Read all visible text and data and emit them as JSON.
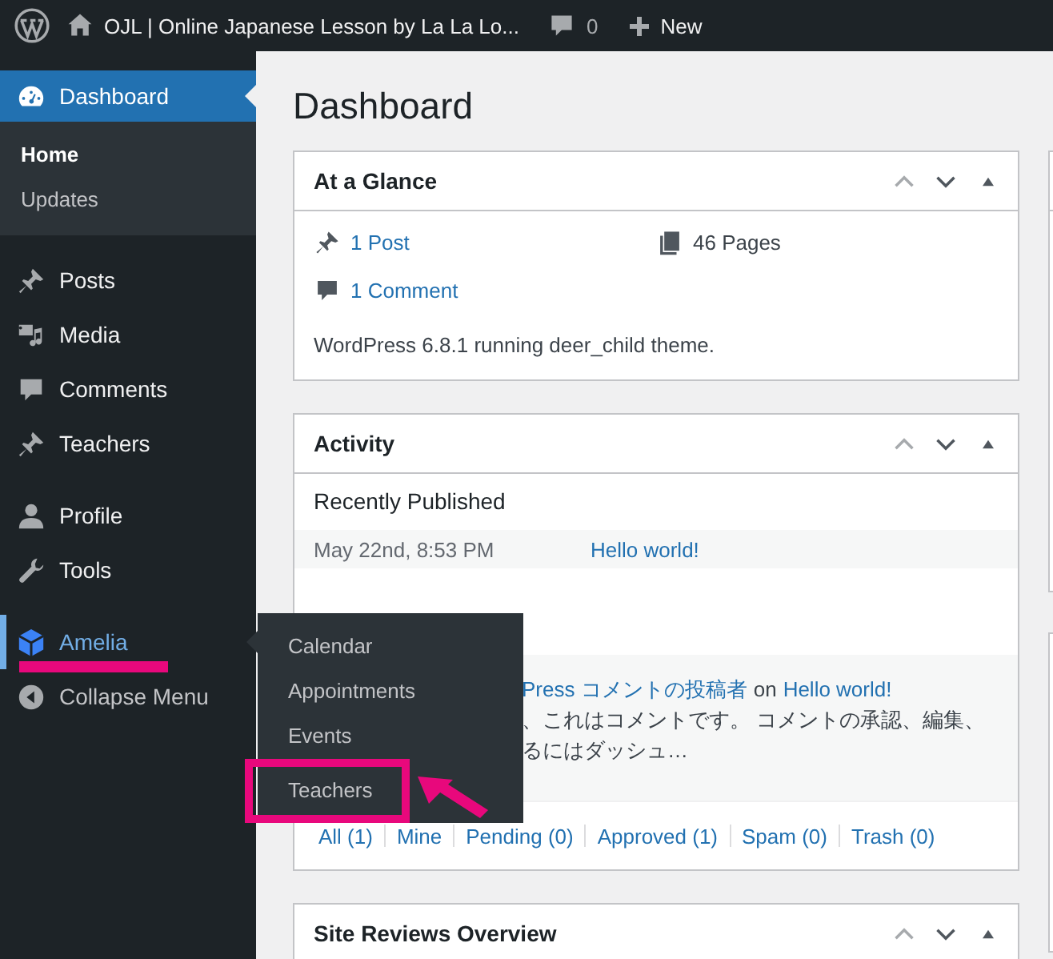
{
  "admin_bar": {
    "site_title": "OJL | Online Japanese Lesson by La La Lo...",
    "comment_count": "0",
    "new_label": "New"
  },
  "sidebar": {
    "groups": [
      [
        {
          "label": "Dashboard",
          "selected": true,
          "hovered": false,
          "underlined": false,
          "children": [
            {
              "label": "Home",
              "selected": true
            },
            {
              "label": "Updates",
              "selected": false
            }
          ]
        }
      ],
      [
        {
          "label": "Posts",
          "selected": false,
          "hovered": false,
          "underlined": false
        },
        {
          "label": "Media",
          "selected": false,
          "hovered": false,
          "underlined": false
        },
        {
          "label": "Comments",
          "selected": false,
          "hovered": false,
          "underlined": false
        },
        {
          "label": "Teachers",
          "selected": false,
          "hovered": false,
          "underlined": false
        }
      ],
      [
        {
          "label": "Profile",
          "selected": false,
          "hovered": false,
          "underlined": false
        },
        {
          "label": "Tools",
          "selected": false,
          "hovered": false,
          "underlined": false
        }
      ],
      [
        {
          "label": "Amelia",
          "selected": false,
          "hovered": true,
          "underlined": true
        }
      ]
    ],
    "collapse_label": "Collapse Menu"
  },
  "flyout": {
    "items": [
      {
        "label": "Calendar",
        "highlighted": false
      },
      {
        "label": "Appointments",
        "highlighted": false
      },
      {
        "label": "Events",
        "highlighted": false
      },
      {
        "label": "Teachers",
        "highlighted": true
      }
    ]
  },
  "page_title": "Dashboard",
  "at_a_glance": {
    "title": "At a Glance",
    "posts": "1 Post",
    "pages": "46 Pages",
    "comments": "1 Comment",
    "version_text": "WordPress 6.8.1 running deer_child theme."
  },
  "activity": {
    "title": "Activity",
    "recent_heading": "Recently Published",
    "published": [
      {
        "date": "May 22nd, 8:53 PM",
        "title": "Hello world!"
      }
    ],
    "comments": [
      {
        "author": "Press コメントの投稿者",
        "on": "on",
        "post": "Hello world!",
        "excerpt": [
          "、これはコメントです。 コメントの承認、編集、",
          "るにはダッシュ…"
        ]
      }
    ],
    "filters": [
      "All (1)",
      "Mine",
      "Pending (0)",
      "Approved (1)",
      "Spam (0)",
      "Trash (0)"
    ]
  },
  "site_reviews": {
    "title": "Site Reviews Overview"
  }
}
